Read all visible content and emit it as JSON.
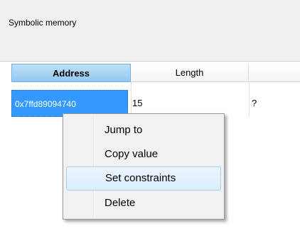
{
  "panel": {
    "title": "Symbolic memory"
  },
  "table": {
    "columns": [
      "Address",
      "Length",
      ""
    ],
    "rows": [
      {
        "address": "0x7ffd89094740",
        "length": "15",
        "extra": "?"
      }
    ]
  },
  "context_menu": {
    "items": [
      {
        "label": "Jump to"
      },
      {
        "label": "Copy value"
      },
      {
        "label": "Set constraints"
      },
      {
        "label": "Delete"
      }
    ],
    "hovered_item": "Set constraints"
  },
  "colors": {
    "selection": "#3399ff",
    "header_selected": "#93c9f0",
    "menu_background": "#f2f2f2"
  }
}
